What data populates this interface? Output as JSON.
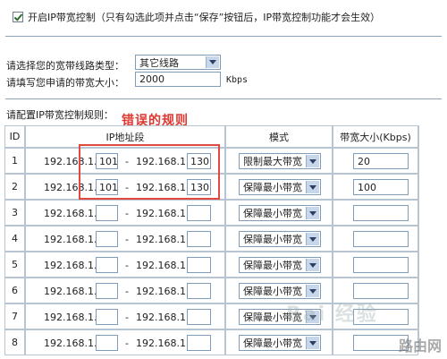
{
  "enable_ip_control": {
    "checked": true,
    "label": "开启IP带宽控制（只有勾选此项并点击“保存”按钮后，IP带宽控制功能才会生效）"
  },
  "line_type": {
    "label": "请选择您的宽带线路类型：",
    "value": "其它线路"
  },
  "bandwidth": {
    "label": "请填写您申请的带宽大小：",
    "value": "2000",
    "unit": "Kbps"
  },
  "table": {
    "title": "请配置IP带宽控制规则：",
    "annotation": "错误的规则",
    "headers": {
      "id": "ID",
      "ip": "IP地址段",
      "mode": "模式",
      "bw": "带宽大小(Kbps)"
    },
    "ip_prefix": "192.168.1.",
    "separator": "-",
    "rows": [
      {
        "id": "1",
        "start": "101",
        "end": "130",
        "mode": "限制最大带宽",
        "bw": "20"
      },
      {
        "id": "2",
        "start": "101",
        "end": "130",
        "mode": "保障最小带宽",
        "bw": "100"
      },
      {
        "id": "3",
        "start": "",
        "end": "",
        "mode": "保障最小带宽",
        "bw": ""
      },
      {
        "id": "4",
        "start": "",
        "end": "",
        "mode": "保障最小带宽",
        "bw": ""
      },
      {
        "id": "5",
        "start": "",
        "end": "",
        "mode": "保障最小带宽",
        "bw": ""
      },
      {
        "id": "6",
        "start": "",
        "end": "",
        "mode": "保障最小带宽",
        "bw": ""
      },
      {
        "id": "7",
        "start": "",
        "end": "",
        "mode": "保障最小带宽",
        "bw": ""
      },
      {
        "id": "8",
        "start": "",
        "end": "",
        "mode": "保障最小带宽",
        "bw": ""
      }
    ]
  },
  "watermark": {
    "text": "路由网",
    "baidu": "Bai 经验"
  },
  "colors": {
    "annotation_red": "#e0362f",
    "border": "#b7c4d2",
    "input_border": "#7f9db9"
  }
}
